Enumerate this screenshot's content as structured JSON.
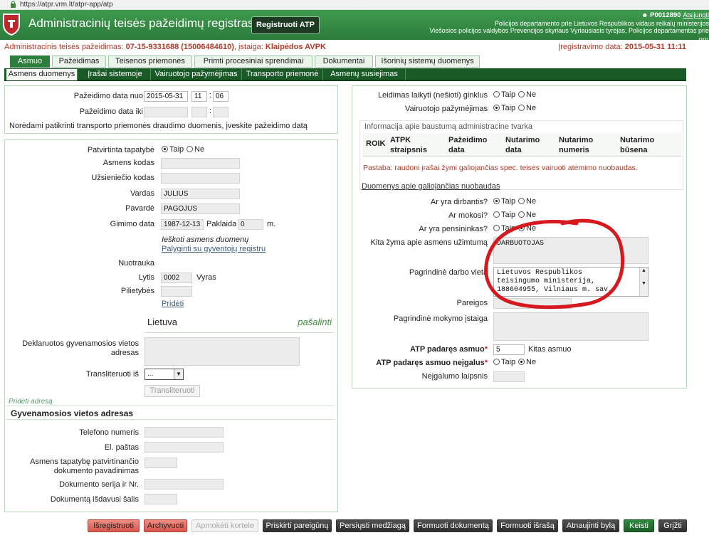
{
  "browser": {
    "url": "https://atpr.vrm.lt/atpr-app/atp"
  },
  "header": {
    "title": "Administracinių teisės pažeidimų registras",
    "register_button": "Registruoti ATP",
    "user_code": "P0012890",
    "logout": "Atsijungti",
    "org_line1": "Policijos departamento prie Lietuvos Respublikos vidaus reikalų ministerijos",
    "org_line2": "Viešosios policijos valdybos Prevencijos skyriaus Vyriausiasis tyrėjas, Policijos departamentas prie",
    "edge_letters": "RRI"
  },
  "info": {
    "prefix": "Administracinis teisės pažeidimas:",
    "case_no": "07-15-9331688 (15006484610)",
    "inst_label": ", įstaiga:",
    "inst": "Klaipėdos AVPK",
    "reg_label": "Įregistravimo data:",
    "reg_date": "2015-05-31",
    "reg_time": "11:11"
  },
  "tabs": [
    "Asmuo",
    "Pažeidimas",
    "Teisenos priemonės",
    "Primti procesiniai sprendimai",
    "Dokumentai",
    "Išorinių sistemų duomenys"
  ],
  "subtabs": [
    "Asmens duomenys",
    "Įrašai sistemoje",
    "Vairuotojo pažymėjimas",
    "Transporto priemonė",
    "Asmenų susiejimas"
  ],
  "date_panel": {
    "from_label": "Pažeidimo data nuo",
    "from_date": "2015-05-31",
    "from_hour": "11",
    "from_min": "06",
    "to_label": "Pažeidimo data iki",
    "colon": ":",
    "note": "Norėdami patikrinti transporto priemonės draudimo duomenis, įveskite pažeidimo datą"
  },
  "person": {
    "confirmed_label": "Patvirtinta tapatybė",
    "yes": "Taip",
    "no": "Ne",
    "code_label": "Asmens kodas",
    "foreign_label": "Užsieniečio kodas",
    "name_label": "Vardas",
    "name": "JULIUS",
    "surname_label": "Pavardė",
    "surname": "PAGOJUS",
    "birth_label": "Gimimo data",
    "birth": "1987-12-13",
    "error_label": "Paklaida",
    "error_val": "0",
    "m": "m.",
    "search_text": "Ieškoti asmens duomenų",
    "compare_link": "Palyginti su gyventojų registru",
    "photo_label": "Nuotrauka",
    "gender_label": "Lytis",
    "gender_code": "0002",
    "gender_text": "Vyras",
    "citizen_label": "Pilietybės",
    "add_link": "Pridėti",
    "country": "Lietuva",
    "remove": "pašalinti",
    "declared_label": "Deklaruotos gyvenamosios vietos adresas",
    "translit_label": "Transliteruoti iš",
    "translit_value": "...",
    "translit_button": "Transliteruoti",
    "add_address": "Pridėti adresą",
    "address_title": "Gyvenamosios vietos adresas",
    "phone_label": "Telefono numeris",
    "email_label": "El. paštas",
    "doc_name_label": "Asmens tapatybę patvirtinančio dokumento pavadinimas",
    "doc_no_label": "Dokumento serija ir Nr.",
    "doc_country_label": "Dokumentą išdavusi šalis"
  },
  "right": {
    "weapon_label": "Leidimas laikyti (nešioti) ginklus",
    "license_label": "Vairuotojo pažymėjimas",
    "punish_title": "Informacija apie baustumą administracine tvarka",
    "table_headers": [
      "ROIK",
      "ATPK straipsnis",
      "Pažeidimo data",
      "Nutarimo data",
      "Nutarimo numeris",
      "Nutarimo būsena"
    ],
    "note": "Pastaba: raudoni įrašai žymi galiojančias spec. teisės vairuoti atėmimo nuobaudas.",
    "valid_link": "Duomenys apie galiojančias nuobaudas",
    "working_label": "Ar yra dirbantis?",
    "studying_label": "Ar mokosi?",
    "pension_label": "Ar yra pensininkas?",
    "occupation_label": "Kita žyma apie asmens užimtumą",
    "occupation": "DARBUOTOJAS",
    "work_label": "Pagrindinė darbo vieta",
    "work_lines": [
      "Lietuvos Respublikos",
      "teisingumo ministerija,",
      "188604955, Vilniaus m. sav."
    ],
    "position_label": "Pareigos",
    "school_label": "Pagrindinė mokymo įstaiga",
    "offender_label": "ATP padaręs asmuo",
    "star": "*",
    "offender_code": "5",
    "offender_text": "Kitas asmuo",
    "disabled_label": "ATP padaręs asmuo neįgalus",
    "disability_label": "Neįgalumo laipsnis"
  },
  "buttons": [
    "Išregistruoti",
    "Archyvuoti",
    "Apmokėti kortele",
    "Priskirti pareigūnų",
    "Persiųsti medžiagą",
    "Formuoti dokumentą",
    "Formuoti išrašą",
    "Atnaujinti bylą",
    "Keisti",
    "Grįžti"
  ],
  "colors": {
    "header_green": "#2f8a42",
    "subbar": "#195a27",
    "accent_red": "#b13a26",
    "annotation": "#d6191f"
  }
}
